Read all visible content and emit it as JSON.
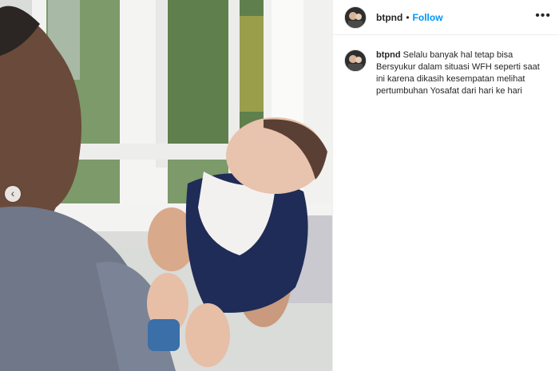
{
  "post": {
    "username": "btpnd",
    "separator": "•",
    "follow_label": "Follow",
    "more_label": "•••",
    "caption": "Selalu banyak hal tetap bisa Bersyukur dalam situasi WFH seperti saat ini karena dikasih kesempatan melihat pertumbuhan Yosafat dari hari ke hari"
  },
  "media": {
    "prev_icon": "‹",
    "type": "video"
  },
  "icons": {
    "avatar": "avatar-icon",
    "prev": "chevron-left-icon",
    "more": "more-options-icon"
  },
  "colors": {
    "follow": "#0095f6",
    "text": "#262626"
  }
}
